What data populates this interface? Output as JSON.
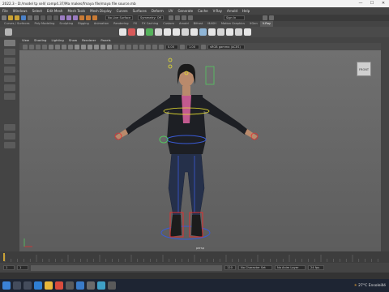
{
  "titlebar": {
    "title": "2022.3 - D:/model tp sell/ comp4.37/Ma makes/fmaya file/maya file source.mb",
    "controls": [
      "minimize-icon",
      "maximize-icon",
      "close-icon"
    ]
  },
  "menubar": {
    "items": [
      "File",
      "Windows",
      "Select",
      "Edit Mesh",
      "Mesh Tools",
      "Mesh Display",
      "Curves",
      "Surfaces",
      "Deform",
      "UV",
      "Generate",
      "Cache",
      "V-Ray",
      "Arnold",
      "Help"
    ]
  },
  "statusline": {
    "live_surface": "No Live Surface",
    "symmetry": "Symmetry: Off",
    "sign_in": "Sign In"
  },
  "shelf": {
    "tabs": [
      "Curves / Surfaces",
      "Poly Modeling",
      "Sculpting",
      "Rigging",
      "Animation",
      "Rendering",
      "FX",
      "FX Caching",
      "Custom",
      "Arnold",
      "Bifrost",
      "MASH",
      "Motion Graphics",
      "XGen",
      "V-Ray"
    ],
    "active_tab": "V-Ray"
  },
  "viewport": {
    "menu": [
      "View",
      "Shading",
      "Lighting",
      "Show",
      "Renderer",
      "Panels"
    ],
    "exposure": "0.00",
    "gamma": "1.00",
    "color_space": "sRGB gamma (ACES)",
    "camera_cube_label": "FRONT",
    "camera_name": "persp"
  },
  "timeslider": {
    "range_start": "1",
    "range_end": "120",
    "current_frame": "1",
    "character_set": "No Character Set",
    "anim_layer": "No Anim Layer",
    "fps": "24 fps"
  },
  "taskbar": {
    "weather": "27°C",
    "weather_label": "Ensoleillé"
  },
  "colors": {
    "body": "#151820",
    "jacket": "#1d1f24",
    "jeans": "#25304a",
    "skin": "#b98a6c",
    "accent_pink": "#c25a8f",
    "rig_blue": "#3a5bd6",
    "rig_yellow": "#e8e030",
    "rig_red": "#e03030",
    "rig_green": "#54c860"
  }
}
